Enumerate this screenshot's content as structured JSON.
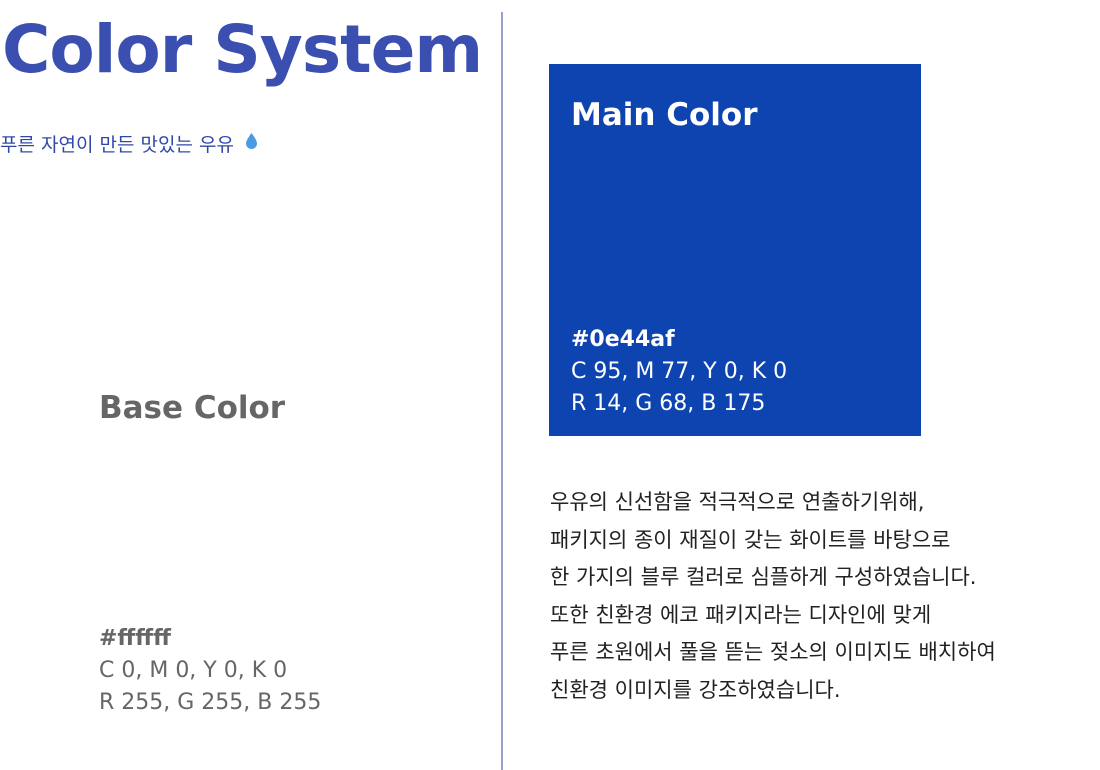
{
  "header": {
    "title": "Color System",
    "subtitle": "푸른 자연이 만든 맛있는 우유",
    "subtitle_icon": "water-drop-icon",
    "title_color": "#3a4fb0",
    "subtitle_color": "#2f49a8",
    "icon_color": "#4a9be3"
  },
  "base_color": {
    "title": "Base Color",
    "hex": "#ffffff",
    "cmyk": "C 0, M 0, Y 0, K 0",
    "rgb": "R 255, G 255, B 255",
    "swatch": "#ffffff",
    "text_color": "#666666"
  },
  "main_color": {
    "title": "Main Color",
    "hex": "#0e44af",
    "cmyk": "C 95, M 77, Y 0, K 0",
    "rgb": "R 14, G 68, B 175",
    "swatch": "#0e44af",
    "text_color": "#ffffff"
  },
  "description": {
    "lines": [
      "우유의 신선함을 적극적으로 연출하기위해,",
      "패키지의 종이 재질이 갖는 화이트를 바탕으로",
      "한 가지의 블루 컬러로 심플하게 구성하였습니다.",
      "또한 친환경 에코 패키지라는 디자인에 맞게",
      "푸른 초원에서 풀을 뜯는 젖소의 이미지도 배치하여",
      "친환경 이미지를 강조하였습니다."
    ]
  },
  "divider_color": "#95a4c6"
}
